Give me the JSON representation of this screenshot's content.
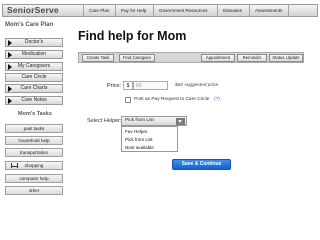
{
  "header": {
    "logo": "SeniorServe",
    "nav": [
      "Care Plan",
      "Pay for Help",
      "Government Resources",
      "Diseases",
      "Assessments"
    ]
  },
  "sidebar": {
    "title": "Mom's Care Plan",
    "items": [
      {
        "label": "Doctor's",
        "has_arrow": true
      },
      {
        "label": "Medication",
        "has_arrow": true
      },
      {
        "label": "My Caregivers",
        "has_arrow": true
      },
      {
        "label": "Care Circle",
        "has_arrow": false
      },
      {
        "label": "Care Charts",
        "has_arrow": true
      },
      {
        "label": "Care Notes",
        "has_arrow": true
      }
    ],
    "tasks_title": "Mom's Tasks",
    "tasks": [
      "past tasks",
      "household help",
      "transportation",
      "shopping",
      "computer help",
      "other"
    ]
  },
  "main": {
    "title": "Find help for Mom",
    "actions": {
      "create_task": "Create Task",
      "find_caregiver": "Find Caregiver",
      "appointment": "Appointment",
      "reminder": "Reminder",
      "status_update": "Status Update"
    },
    "price": {
      "label": "Price:",
      "currency": "$",
      "placeholder": "60",
      "suggested": "$60 suggested price"
    },
    "post_checkbox_label": "Post as Pay Request to Care Circle",
    "help_marker": "(?)",
    "helper": {
      "label": "Select Helper:",
      "selected": "Pick from List",
      "options": [
        "Fav Helper",
        "Pick from List",
        "Next available"
      ]
    },
    "save_label": "Save & Continue"
  },
  "colors": {
    "primary_button": "#1f6fe0",
    "help_link": "#1a64c8"
  }
}
